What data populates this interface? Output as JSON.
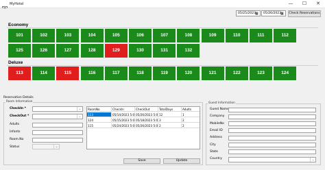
{
  "window": {
    "title": "MyHotel",
    "minimize": "—",
    "maximize": "☐",
    "close": "✕"
  },
  "toolbar": {
    "checkin_date": "05/25/2023",
    "checkout_date": "05/26/2023",
    "check_button": "Check Reservations"
  },
  "categories": [
    {
      "name": "Economy",
      "rooms": [
        {
          "no": "101",
          "status": "free"
        },
        {
          "no": "102",
          "status": "free"
        },
        {
          "no": "103",
          "status": "free"
        },
        {
          "no": "104",
          "status": "free"
        },
        {
          "no": "105",
          "status": "free"
        },
        {
          "no": "106",
          "status": "free"
        },
        {
          "no": "107",
          "status": "free"
        },
        {
          "no": "108",
          "status": "free"
        },
        {
          "no": "109",
          "status": "free"
        },
        {
          "no": "110",
          "status": "free"
        },
        {
          "no": "111",
          "status": "free"
        },
        {
          "no": "112",
          "status": "free"
        },
        {
          "no": "125",
          "status": "free"
        },
        {
          "no": "126",
          "status": "free"
        },
        {
          "no": "127",
          "status": "free"
        },
        {
          "no": "128",
          "status": "free"
        },
        {
          "no": "129",
          "status": "occupied"
        },
        {
          "no": "130",
          "status": "free"
        },
        {
          "no": "131",
          "status": "free"
        },
        {
          "no": "132",
          "status": "free"
        }
      ]
    },
    {
      "name": "Deluxe",
      "rooms": [
        {
          "no": "113",
          "status": "occupied"
        },
        {
          "no": "114",
          "status": "free"
        },
        {
          "no": "115",
          "status": "occupied"
        },
        {
          "no": "116",
          "status": "free"
        },
        {
          "no": "117",
          "status": "free"
        },
        {
          "no": "118",
          "status": "free"
        },
        {
          "no": "119",
          "status": "free"
        },
        {
          "no": "120",
          "status": "free"
        },
        {
          "no": "121",
          "status": "free"
        },
        {
          "no": "122",
          "status": "free"
        },
        {
          "no": "123",
          "status": "free"
        },
        {
          "no": "124",
          "status": "free"
        }
      ]
    }
  ],
  "colors": {
    "free": "#1a8a1a",
    "occupied": "#e01e1e",
    "selected_row": "#0078d7"
  },
  "reservation": {
    "title": "Reservation Details",
    "room_info": {
      "title": "Room Information",
      "checkin_label": "CheckIn *",
      "checkout_label": "CheckOut *",
      "adults_label": "Adults",
      "infants_label": "Infants",
      "roomno_label": "Room.No",
      "status_label": "Status"
    },
    "grid": {
      "columns": [
        "RoomNo",
        "CheckIn",
        "CheckOut",
        "TotalDays",
        "Adults"
      ],
      "rows": [
        [
          "113",
          "05/14/2023 5:03...",
          "05/26/2023 5:03...",
          "12",
          "1"
        ],
        [
          "124",
          "05/15/2023 5:03...",
          "05/18/2023 5:03...",
          "3",
          "2"
        ],
        [
          "115",
          "05/24/2023 5:03...",
          "05/26/2023 5:03...",
          "2",
          "2"
        ]
      ]
    },
    "save_button": "Save",
    "update_button": "Update"
  },
  "guest_info": {
    "title": "Guest Information",
    "fields": [
      "Guest Name",
      "Company",
      "MobileNo",
      "Email ID",
      "Address",
      "City",
      "State",
      "Country"
    ]
  }
}
